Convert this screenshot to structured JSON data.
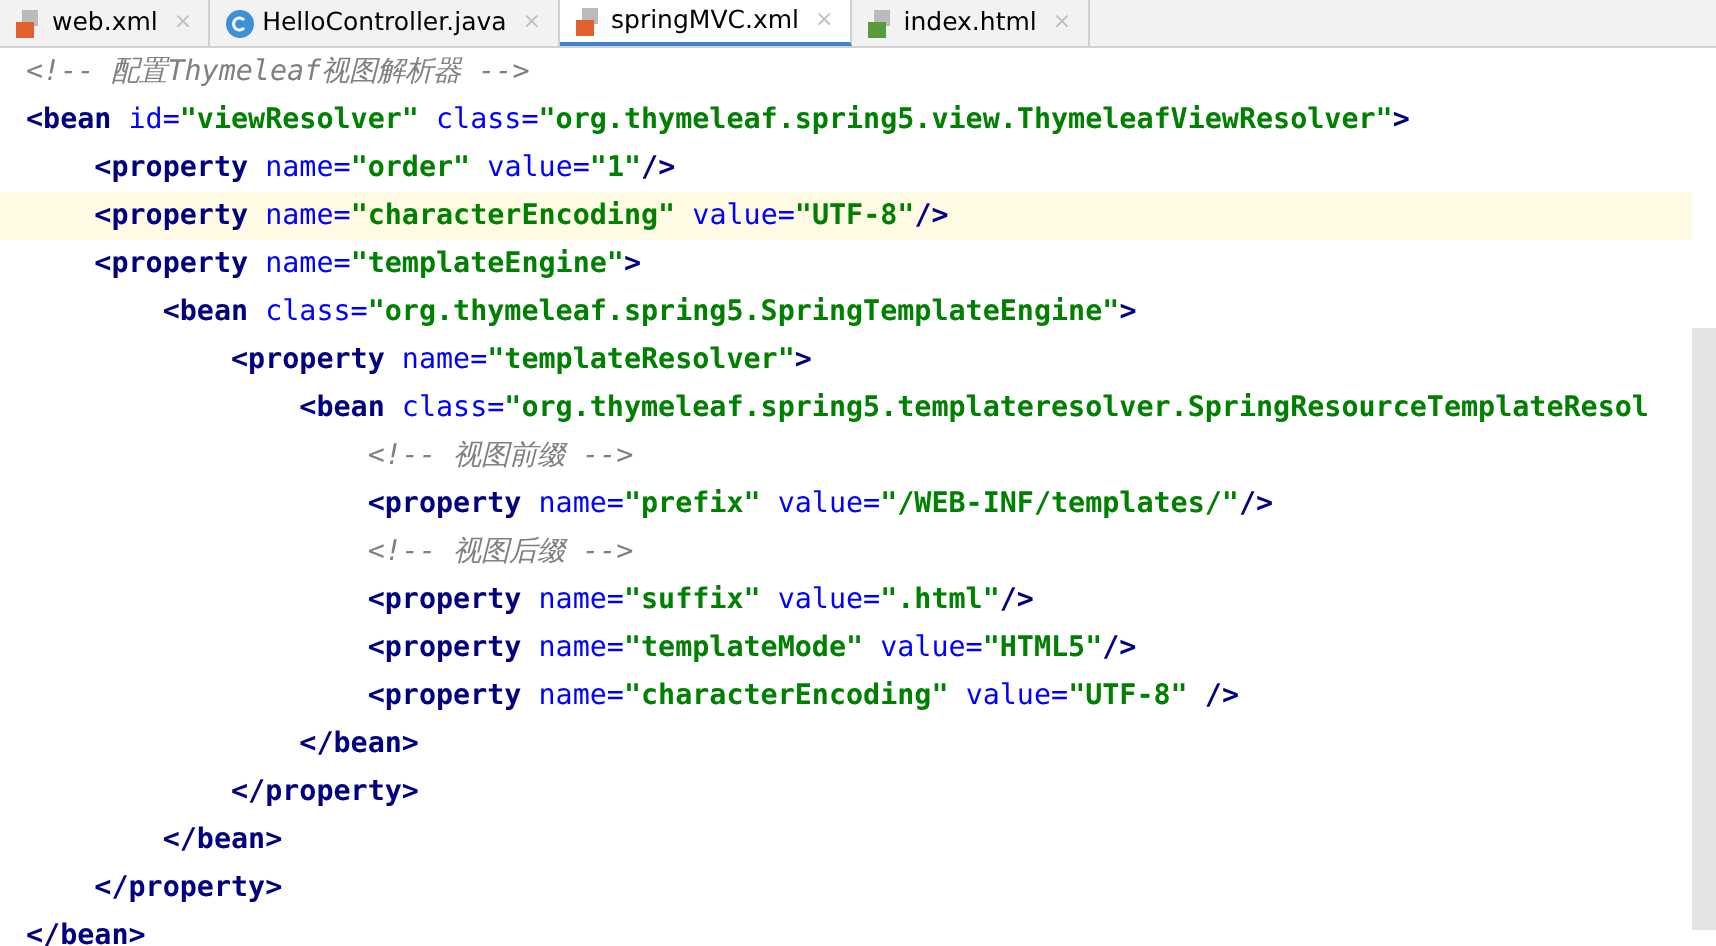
{
  "tabs": [
    {
      "label": "web.xml",
      "kind": "xml",
      "selected": false,
      "close": "×"
    },
    {
      "label": "HelloController.java",
      "kind": "java",
      "selected": false,
      "close": "×"
    },
    {
      "label": "springMVC.xml",
      "kind": "xml",
      "selected": true,
      "close": "×"
    },
    {
      "label": "index.html",
      "kind": "html",
      "selected": false,
      "close": "×"
    }
  ],
  "lines": [
    {
      "current": false,
      "tokens": [
        {
          "kind": "comment",
          "text": "<!-- 配置Thymeleaf视图解析器 -->"
        }
      ]
    },
    {
      "current": false,
      "tokens": [
        {
          "kind": "tag",
          "text": "<bean "
        },
        {
          "kind": "attr",
          "text": "id="
        },
        {
          "kind": "value",
          "text": "\"viewResolver\" "
        },
        {
          "kind": "attr",
          "text": "class="
        },
        {
          "kind": "value",
          "text": "\"org.thymeleaf.spring5.view.ThymeleafViewResolver\""
        },
        {
          "kind": "tag",
          "text": ">"
        }
      ]
    },
    {
      "current": false,
      "tokens": [
        {
          "kind": "tag",
          "text": "    <property "
        },
        {
          "kind": "attr",
          "text": "name="
        },
        {
          "kind": "value",
          "text": "\"order\" "
        },
        {
          "kind": "attr",
          "text": "value="
        },
        {
          "kind": "value",
          "text": "\"1\""
        },
        {
          "kind": "tag",
          "text": "/>"
        }
      ]
    },
    {
      "current": true,
      "tokens": [
        {
          "kind": "tag",
          "text": "    <property "
        },
        {
          "kind": "attr",
          "text": "name="
        },
        {
          "kind": "value",
          "text": "\"characterEncoding\" "
        },
        {
          "kind": "attr",
          "text": "value="
        },
        {
          "kind": "value",
          "text": "\"UTF-8\""
        },
        {
          "kind": "tag",
          "text": "/>"
        }
      ]
    },
    {
      "current": false,
      "tokens": [
        {
          "kind": "tag",
          "text": "    <property "
        },
        {
          "kind": "attr",
          "text": "name="
        },
        {
          "kind": "value",
          "text": "\"templateEngine\""
        },
        {
          "kind": "tag",
          "text": ">"
        }
      ]
    },
    {
      "current": false,
      "tokens": [
        {
          "kind": "tag",
          "text": "        <bean "
        },
        {
          "kind": "attr",
          "text": "class="
        },
        {
          "kind": "value",
          "text": "\"org.thymeleaf.spring5.SpringTemplateEngine\""
        },
        {
          "kind": "tag",
          "text": ">"
        }
      ]
    },
    {
      "current": false,
      "tokens": [
        {
          "kind": "tag",
          "text": "            <property "
        },
        {
          "kind": "attr",
          "text": "name="
        },
        {
          "kind": "value",
          "text": "\"templateResolver\""
        },
        {
          "kind": "tag",
          "text": ">"
        }
      ]
    },
    {
      "current": false,
      "tokens": [
        {
          "kind": "tag",
          "text": "                <bean "
        },
        {
          "kind": "attr",
          "text": "class="
        },
        {
          "kind": "value",
          "text": "\"org.thymeleaf.spring5.templateresolver.SpringResourceTemplateResol"
        }
      ]
    },
    {
      "current": false,
      "tokens": [
        {
          "kind": "comment",
          "text": "                    <!-- 视图前缀 -->"
        }
      ]
    },
    {
      "current": false,
      "tokens": [
        {
          "kind": "tag",
          "text": "                    <property "
        },
        {
          "kind": "attr",
          "text": "name="
        },
        {
          "kind": "value",
          "text": "\"prefix\" "
        },
        {
          "kind": "attr",
          "text": "value="
        },
        {
          "kind": "value",
          "text": "\"/WEB-INF/templates/\""
        },
        {
          "kind": "tag",
          "text": "/>"
        }
      ]
    },
    {
      "current": false,
      "tokens": [
        {
          "kind": "comment",
          "text": "                    <!-- 视图后缀 -->"
        }
      ]
    },
    {
      "current": false,
      "tokens": [
        {
          "kind": "tag",
          "text": "                    <property "
        },
        {
          "kind": "attr",
          "text": "name="
        },
        {
          "kind": "value",
          "text": "\"suffix\" "
        },
        {
          "kind": "attr",
          "text": "value="
        },
        {
          "kind": "value",
          "text": "\".html\""
        },
        {
          "kind": "tag",
          "text": "/>"
        }
      ]
    },
    {
      "current": false,
      "tokens": [
        {
          "kind": "tag",
          "text": "                    <property "
        },
        {
          "kind": "attr",
          "text": "name="
        },
        {
          "kind": "value",
          "text": "\"templateMode\" "
        },
        {
          "kind": "attr",
          "text": "value="
        },
        {
          "kind": "value",
          "text": "\"HTML5\""
        },
        {
          "kind": "tag",
          "text": "/>"
        }
      ]
    },
    {
      "current": false,
      "tokens": [
        {
          "kind": "tag",
          "text": "                    <property "
        },
        {
          "kind": "attr",
          "text": "name="
        },
        {
          "kind": "value",
          "text": "\"characterEncoding\" "
        },
        {
          "kind": "attr",
          "text": "value="
        },
        {
          "kind": "value",
          "text": "\"UTF-8\" "
        },
        {
          "kind": "tag",
          "text": "/>"
        }
      ]
    },
    {
      "current": false,
      "tokens": [
        {
          "kind": "tag",
          "text": "                </bean>"
        }
      ]
    },
    {
      "current": false,
      "tokens": [
        {
          "kind": "tag",
          "text": "            </property>"
        }
      ]
    },
    {
      "current": false,
      "tokens": [
        {
          "kind": "tag",
          "text": "        </bean>"
        }
      ]
    },
    {
      "current": false,
      "tokens": [
        {
          "kind": "tag",
          "text": "    </property>"
        }
      ]
    },
    {
      "current": false,
      "tokens": [
        {
          "kind": "tag",
          "text": "</bean>"
        }
      ]
    }
  ]
}
